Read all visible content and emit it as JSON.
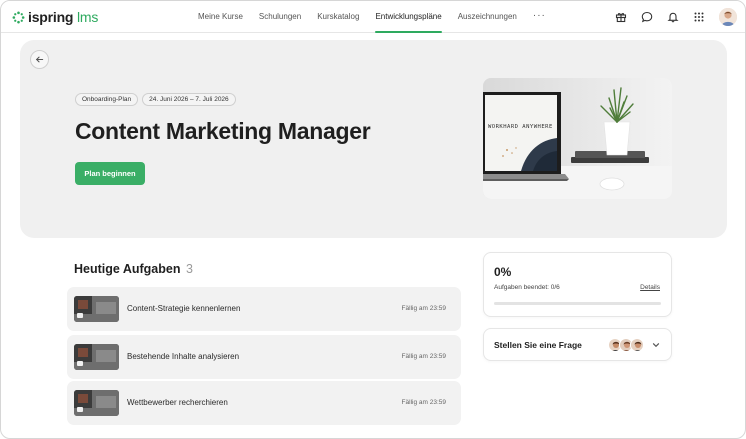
{
  "brand": {
    "name": "ispring",
    "suffix": "lms",
    "accent": "#2eaa5f"
  },
  "nav": {
    "items": [
      "Meine Kurse",
      "Schulungen",
      "Kurskatalog",
      "Entwicklungspläne",
      "Auszeichnungen"
    ],
    "active": "Entwicklungspläne",
    "more": "···"
  },
  "header_icons": [
    "gift-icon",
    "chat-bubble-icon",
    "bell-icon",
    "apps-grid-icon",
    "user-avatar"
  ],
  "hero": {
    "tags": [
      "Onboarding-Plan",
      "24. Juni 2026 – 7. Juli 2026"
    ],
    "title": "Content Marketing Manager",
    "cta": "Plan beginnen",
    "image_caption": "WORKHARD ANYWHERE"
  },
  "tasks": {
    "title": "Heutige Aufgaben",
    "count": "3",
    "items": [
      {
        "label": "Content-Strategie kennenlernen",
        "due": "Fällig am 23:59"
      },
      {
        "label": "Bestehende Inhalte analysieren",
        "due": "Fällig am 23:59"
      },
      {
        "label": "Wettbewerber recherchieren",
        "due": "Fällig am 23:59"
      }
    ]
  },
  "progress": {
    "percent_text": "0%",
    "done_text": "Aufgaben beendet: 0/6",
    "details_link": "Details",
    "value": 0
  },
  "ask": {
    "label": "Stellen Sie eine Frage"
  }
}
